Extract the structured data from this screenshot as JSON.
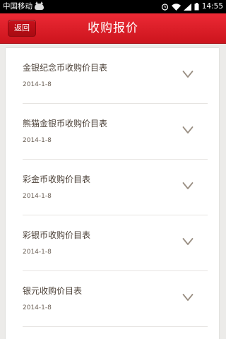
{
  "status_bar": {
    "carrier": "中国移动",
    "time": "14:55",
    "icons": [
      "cat-notification-icon",
      "alarm-icon",
      "wifi-icon",
      "signal-icon",
      "battery-icon"
    ]
  },
  "header": {
    "back_label": "返回",
    "title": "收购报价"
  },
  "colors": {
    "header_red": "#d81e28",
    "text_brown": "#4a3f36",
    "chevron": "#9a8f83",
    "background": "#ecebe9"
  },
  "list": {
    "items": [
      {
        "title": "金银纪念币收购价目表",
        "date": "2014-1-8"
      },
      {
        "title": "熊猫金银币收购价目表",
        "date": "2014-1-8"
      },
      {
        "title": "彩金币收购价目表",
        "date": "2014-1-8"
      },
      {
        "title": "彩银币收购价目表",
        "date": "2014-1-8"
      },
      {
        "title": "银元收购价目表",
        "date": "2014-1-8"
      }
    ]
  }
}
